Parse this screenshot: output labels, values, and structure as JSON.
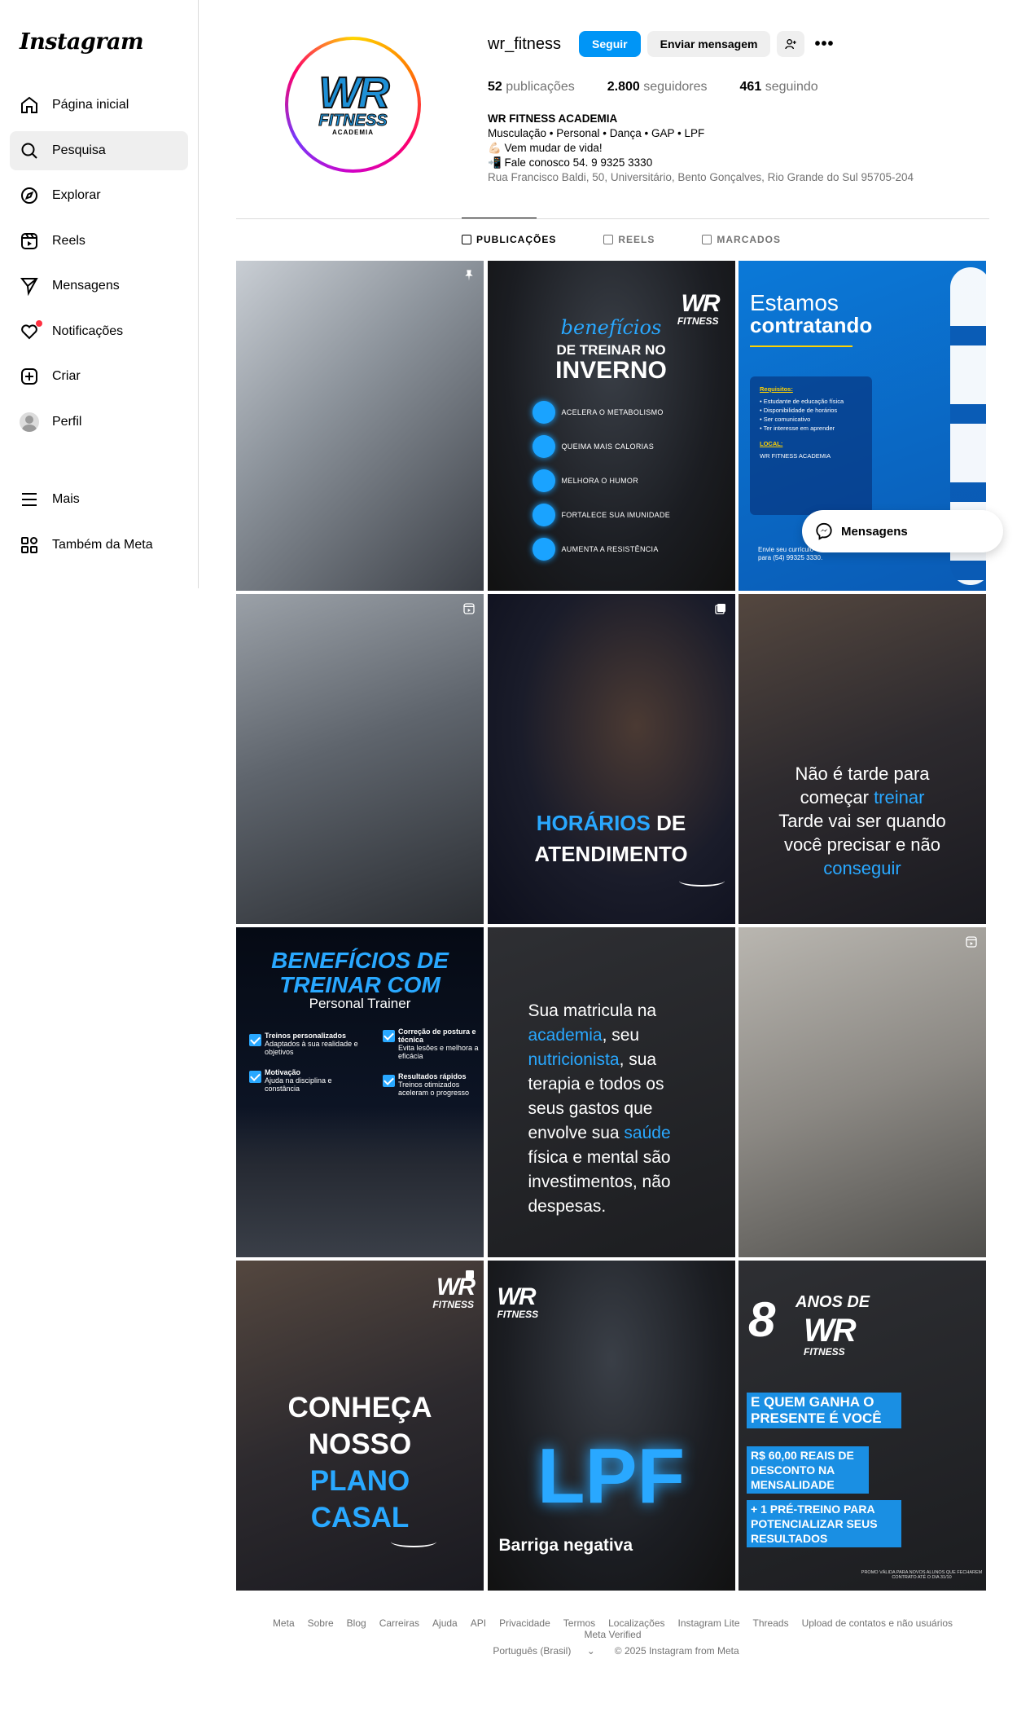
{
  "app": {
    "logo": "Instagram"
  },
  "sidebar": {
    "items": [
      {
        "label": "Página inicial",
        "icon": "home-icon"
      },
      {
        "label": "Pesquisa",
        "icon": "search-icon",
        "active": true
      },
      {
        "label": "Explorar",
        "icon": "compass-icon"
      },
      {
        "label": "Reels",
        "icon": "reels-icon"
      },
      {
        "label": "Mensagens",
        "icon": "send-icon"
      },
      {
        "label": "Notificações",
        "icon": "heart-icon"
      },
      {
        "label": "Criar",
        "icon": "plus-square-icon"
      },
      {
        "label": "Perfil",
        "icon": "avatar"
      }
    ],
    "bottom": [
      {
        "label": "Mais",
        "icon": "menu-icon"
      },
      {
        "label": "Também da Meta",
        "icon": "grid-icon"
      }
    ]
  },
  "profile": {
    "username": "wr_fitness",
    "follow_label": "Seguir",
    "message_label": "Enviar mensagem",
    "more": "•••",
    "posts_count": "52",
    "posts_label": "publicações",
    "followers_count": "2.800",
    "followers_label": "seguidores",
    "following_count": "461",
    "following_label": "seguindo",
    "logo": {
      "wr": "WR",
      "fitness": "FITNESS",
      "academia": "ACADEMIA"
    },
    "bio": {
      "name": "WR FITNESS ACADEMIA",
      "line1": "Musculação • Personal • Dança • GAP • LPF",
      "line2": "💪🏻 Vem mudar de vida!",
      "line3": "📲 Fale conosco 54. 9 9325 3330",
      "address": "Rua Francisco Baldi, 50, Universitário, Bento Gonçalves, Rio Grande do Sul 95705-204"
    }
  },
  "tabs": [
    "PUBLICAÇÕES",
    "REELS",
    "MARCADOS"
  ],
  "posts": {
    "p2": {
      "brand": "WR",
      "brand_sub": "FITNESS",
      "script": "benefícios",
      "title1": "DE TREINAR NO",
      "title2": "INVERNO",
      "items": [
        "ACELERA O METABOLISMO",
        "QUEIMA MAIS CALORIAS",
        "MELHORA O HUMOR",
        "FORTALECE SUA IMUNIDADE",
        "AUMENTA A RESISTÊNCIA"
      ]
    },
    "p3": {
      "t1": "Estamos",
      "t2": "contratando",
      "req_title": "Requisitos:",
      "reqs": [
        "• Estudante de educação física",
        "• Disponibilidade de horários",
        "• Ser comunicativo",
        "• Ter interesse em aprender"
      ],
      "local_title": "LOCAL:",
      "local": "WR FITNESS ACADEMIA",
      "foot1": "Envie seu currículo",
      "foot2": "para (54) 99325 3330."
    },
    "p5": {
      "t1": "HORÁRIOS",
      "t1b": "DE",
      "t2": "ATENDIMENTO"
    },
    "p6": {
      "l1": "Não é tarde para",
      "l2a": "começar",
      "l2b": "treinar",
      "l3": "Tarde vai ser quando",
      "l4": "você precisar e não",
      "l5": "conseguir"
    },
    "p7": {
      "t1": "BENEFÍCIOS DE",
      "t2": "TREINAR COM",
      "sub": "Personal Trainer",
      "boxes": [
        {
          "title": "Treinos personalizados",
          "desc": "Adaptados à sua realidade e objetivos"
        },
        {
          "title": "Correção de postura e técnica",
          "desc": "Evita lesões e melhora a eficácia"
        },
        {
          "title": "Motivação",
          "desc": "Ajuda na disciplina e constância"
        },
        {
          "title": "Resultados rápidos",
          "desc": "Treinos otimizados aceleram o progresso"
        }
      ]
    },
    "p8": {
      "l1": "Sua matricula na",
      "l2a": "academia",
      "l2b": ", seu",
      "l3a": "nutricionista",
      "l3b": ", sua",
      "l4": "terapia e todos os",
      "l5": "seus gastos que",
      "l6a": "envolve sua",
      "l6b": "saúde",
      "l7": "física e mental são",
      "l8": "investimentos, não",
      "l9": "despesas."
    },
    "p10": {
      "brand": "WR",
      "brand_sub": "FITNESS",
      "l1": "CONHEÇA",
      "l2": "NOSSO",
      "l3": "PLANO",
      "l4": "CASAL"
    },
    "p11": {
      "brand": "WR",
      "brand_sub": "FITNESS",
      "big": "LPF",
      "sub": "Barriga negativa"
    },
    "p12": {
      "num": "8",
      "anos": "ANOS DE",
      "brand": "WR",
      "brand_sub": "FITNESS",
      "tag1": "E QUEM GANHA O PRESENTE É VOCÊ",
      "tag2": "R$ 60,00 REAIS DE DESCONTO NA MENSALIDADE",
      "tag3": "+ 1 PRÉ-TREINO PARA POTENCIALIZAR SEUS RESULTADOS",
      "fine": "PROMO VÁLIDA PARA NOVOS ALUNOS QUE FECHAREM CONTRATO ATÉ O DIA 31/10"
    }
  },
  "messages_pill": "Mensagens",
  "footer": {
    "links": [
      "Meta",
      "Sobre",
      "Blog",
      "Carreiras",
      "Ajuda",
      "API",
      "Privacidade",
      "Termos",
      "Localizações",
      "Instagram Lite",
      "Threads",
      "Upload de contatos e não usuários",
      "Meta Verified"
    ],
    "language": "Português (Brasil)",
    "copyright": "© 2025 Instagram from Meta"
  },
  "colors": {
    "accent": "#0095f6",
    "brand_blue": "#29a8ff",
    "notification": "#ff3040"
  }
}
